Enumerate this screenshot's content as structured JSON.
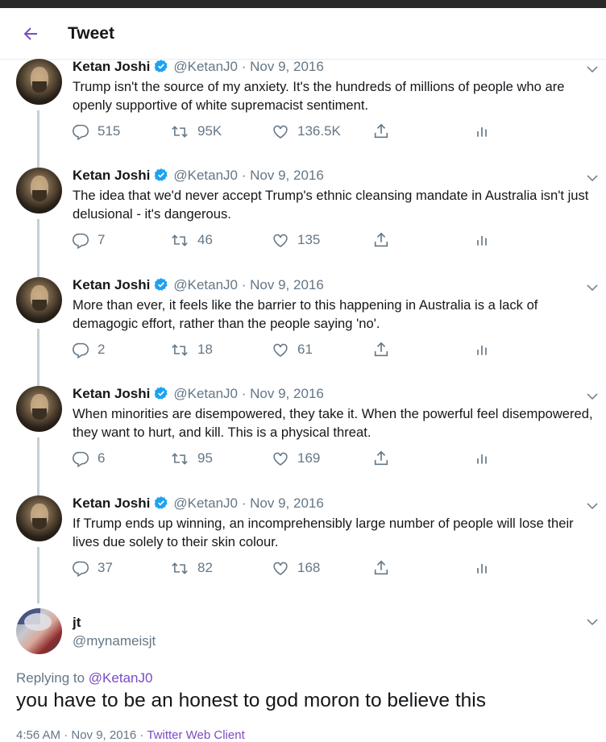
{
  "header": {
    "title": "Tweet"
  },
  "tweets": [
    {
      "name": "Ketan Joshi",
      "handle": "@KetanJ0",
      "sep": "·",
      "date": "Nov 9, 2016",
      "text": "Trump isn't the source of my anxiety. It's the hundreds of millions of people who are openly supportive of white supremacist sentiment.",
      "replies": "515",
      "retweets": "95K",
      "likes": "136.5K"
    },
    {
      "name": "Ketan Joshi",
      "handle": "@KetanJ0",
      "sep": "·",
      "date": "Nov 9, 2016",
      "text": "The idea that we'd never accept Trump's ethnic cleansing mandate in Australia isn't just delusional - it's dangerous.",
      "replies": "7",
      "retweets": "46",
      "likes": "135"
    },
    {
      "name": "Ketan Joshi",
      "handle": "@KetanJ0",
      "sep": "·",
      "date": "Nov 9, 2016",
      "text": "More than ever, it feels like the barrier to this happening in Australia is a lack of demagogic effort, rather than the people saying 'no'.",
      "replies": "2",
      "retweets": "18",
      "likes": "61"
    },
    {
      "name": "Ketan Joshi",
      "handle": "@KetanJ0",
      "sep": "·",
      "date": "Nov 9, 2016",
      "text": "When minorities are disempowered, they take it. When the powerful feel disempowered, they want to hurt, and kill. This is a physical threat.",
      "replies": "6",
      "retweets": "95",
      "likes": "169"
    },
    {
      "name": "Ketan Joshi",
      "handle": "@KetanJ0",
      "sep": "·",
      "date": "Nov 9, 2016",
      "text": "If Trump ends up winning, an incomprehensibly large number of people will lose their lives due solely to their skin colour.",
      "replies": "37",
      "retweets": "82",
      "likes": "168"
    }
  ],
  "reply": {
    "name": "jt",
    "handle": "@mynameisjt",
    "replying_prefix": "Replying to",
    "replying_to": "@KetanJ0",
    "text": "you have to be an honest to god moron to believe this",
    "time": "4:56 AM · Nov 9, 2016 · ",
    "client": "Twitter Web Client"
  },
  "colors": {
    "accent": "#794bc4",
    "verified": "#1da1f2",
    "muted": "#657786"
  },
  "icons": [
    "back-arrow-icon",
    "verified-badge-icon",
    "chevron-down-icon",
    "reply-icon",
    "retweet-icon",
    "like-icon",
    "share-icon",
    "analytics-icon"
  ]
}
